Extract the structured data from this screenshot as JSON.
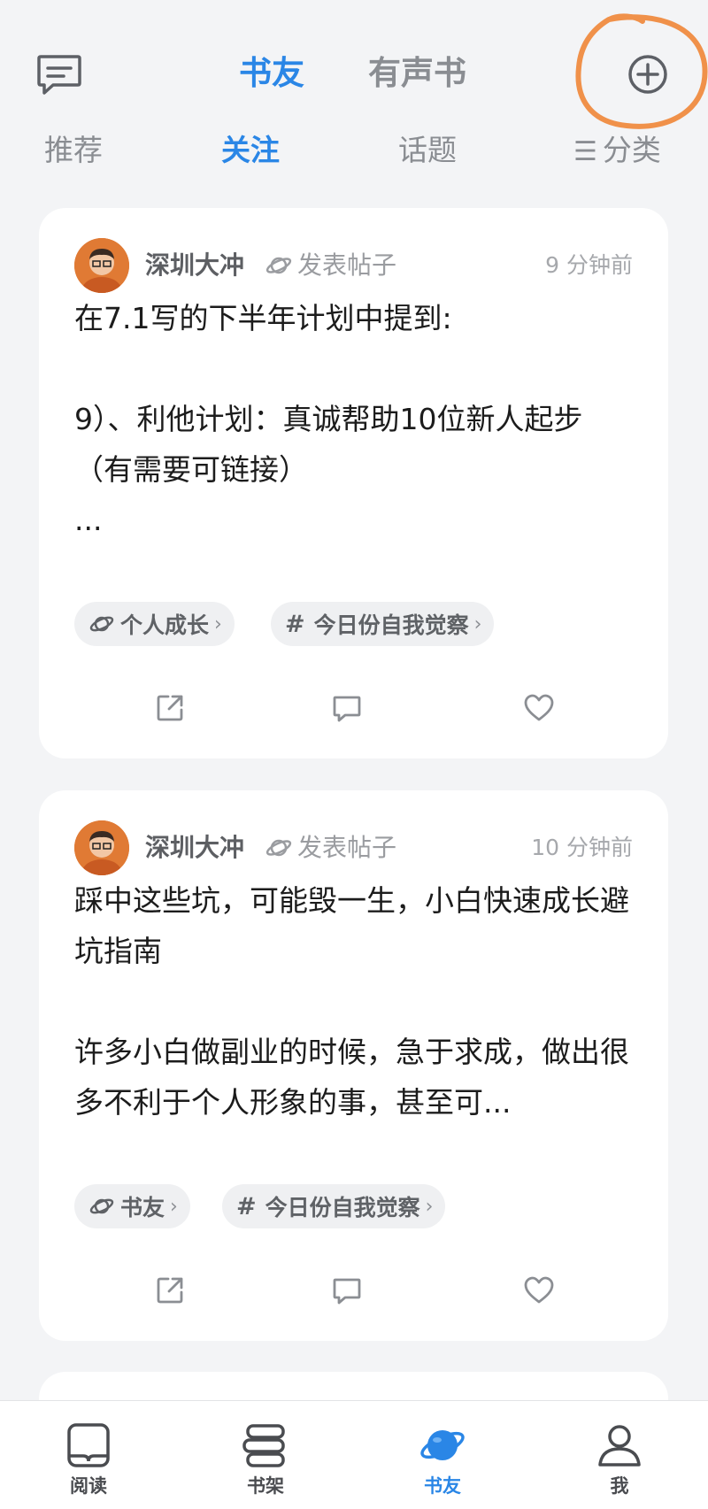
{
  "header": {
    "tabs": [
      {
        "label": "书友",
        "active": true
      },
      {
        "label": "有声书",
        "active": false
      }
    ],
    "icons": {
      "left": "message-icon",
      "right": "add-circle-icon"
    }
  },
  "sub_tabs": {
    "items": [
      {
        "label": "推荐",
        "active": false
      },
      {
        "label": "关注",
        "active": true
      },
      {
        "label": "话题",
        "active": false
      },
      {
        "label": "分类",
        "active": false,
        "icon": "menu-lines-icon"
      }
    ]
  },
  "posts": [
    {
      "author": "深圳大冲",
      "action": "发表帖子",
      "time": "9 分钟前",
      "text": "在7.1写的下半年计划中提到:\n\n9）、利他计划：真诚帮助10位新人起步（有需要可链接）\n...",
      "tags": [
        {
          "icon": "planet-icon",
          "label": "个人成长"
        },
        {
          "icon": "hash-icon",
          "label": "今日份自我觉察"
        }
      ]
    },
    {
      "author": "深圳大冲",
      "action": "发表帖子",
      "time": "10 分钟前",
      "text": "踩中这些坑，可能毁一生，小白快速成长避坑指南\n\n许多小白做副业的时候，急于求成，做出很多不利于个人形象的事，甚至可...",
      "tags": [
        {
          "icon": "planet-icon",
          "label": "书友"
        },
        {
          "icon": "hash-icon",
          "label": "今日份自我觉察"
        }
      ]
    }
  ],
  "bottom_nav": [
    {
      "label": "阅读",
      "icon": "book-icon",
      "active": false
    },
    {
      "label": "书架",
      "icon": "bookshelf-icon",
      "active": false
    },
    {
      "label": "书友",
      "icon": "planet-icon",
      "active": true
    },
    {
      "label": "我",
      "icon": "profile-icon",
      "active": false
    }
  ],
  "colors": {
    "accent": "#2a86e6",
    "annotation": "#f0914a",
    "background": "#f3f4f6"
  }
}
